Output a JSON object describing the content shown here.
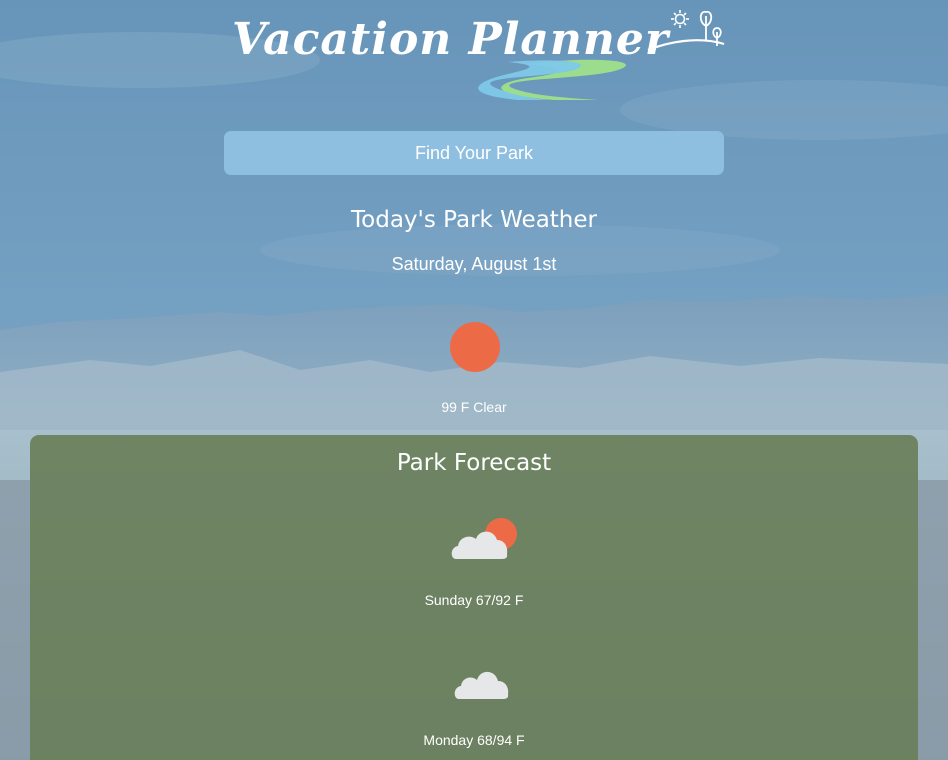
{
  "header": {
    "logo_text": "Vacation Planner"
  },
  "search": {
    "button_label": "Find Your Park"
  },
  "today": {
    "title": "Today's Park Weather",
    "date": "Saturday, August 1st",
    "icon": "sun-icon",
    "condition": "99 F Clear"
  },
  "forecast": {
    "title": "Park Forecast",
    "days": [
      {
        "icon": "partly-cloudy-icon",
        "label": "Sunday 67/92 F"
      },
      {
        "icon": "cloud-icon",
        "label": "Monday 68/94 F"
      }
    ]
  },
  "colors": {
    "sun": "#ec6b46",
    "cloud": "#e6e7e9",
    "button": "#8fbfe0",
    "panel": "#687d58"
  }
}
